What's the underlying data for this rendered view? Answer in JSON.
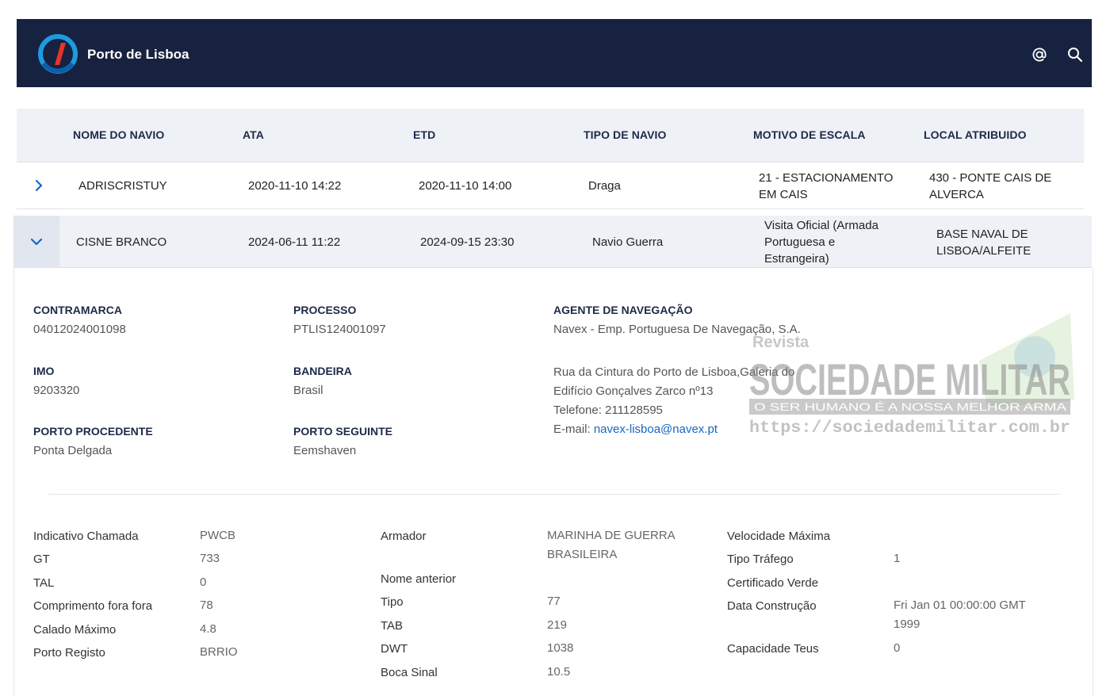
{
  "header": {
    "app_title": "Porto de Lisboa",
    "icons": [
      "at-icon",
      "search-icon"
    ]
  },
  "table": {
    "columns": [
      "NOME DO NAVIO",
      "ATA",
      "ETD",
      "TIPO DE NAVIO",
      "MOTIVO DE ESCALA",
      "LOCAL ATRIBUIDO"
    ],
    "rows": [
      {
        "name": "ADRISCRISTUY",
        "ata": "2020-11-10 14:22",
        "etd": "2020-11-10 14:00",
        "tipo": "Draga",
        "motivo": [
          "21 - ESTACIONAMENTO",
          "EM CAIS"
        ],
        "local": [
          "430 - PONTE CAIS DE",
          "ALVERCA"
        ],
        "expanded": false
      },
      {
        "name": "CISNE BRANCO",
        "ata": "2024-06-11 11:22",
        "etd": "2024-09-15 23:30",
        "tipo": "Navio Guerra",
        "motivo": [
          "Visita Oficial (Armada",
          "Portuguesa e",
          "Estrangeira)"
        ],
        "local": [
          "BASE NAVAL DE",
          "LISBOA/ALFEITE"
        ],
        "expanded": true
      }
    ]
  },
  "detail": {
    "contramarca": {
      "label": "CONTRAMARCA",
      "value": "04012024001098"
    },
    "processo": {
      "label": "PROCESSO",
      "value": "PTLIS124001097"
    },
    "agente": {
      "label": "AGENTE DE NAVEGAÇÃO",
      "name": "Navex - Emp. Portuguesa De Navegação, S.A.",
      "addr1": "Rua da Cintura do Porto de Lisboa,Galeria do",
      "addr2": "Edifício Gonçalves Zarco nº13",
      "phone": "Telefone: 211128595",
      "email_label": "E-mail: ",
      "email": "navex-lisboa@navex.pt"
    },
    "imo": {
      "label": "IMO",
      "value": "9203320"
    },
    "bandeira": {
      "label": "BANDEIRA",
      "value": "Brasil"
    },
    "porto_procedente": {
      "label": "PORTO PROCEDENTE",
      "value": "Ponta Delgada"
    },
    "porto_seguinte": {
      "label": "PORTO SEGUINTE",
      "value": "Eemshaven"
    },
    "specs_col1": [
      {
        "k": "Indicativo Chamada",
        "v": "PWCB"
      },
      {
        "k": "GT",
        "v": "733"
      },
      {
        "k": "TAL",
        "v": "0"
      },
      {
        "k": "Comprimento fora fora",
        "v": "78"
      },
      {
        "k": "Calado Máximo",
        "v": "4.8"
      },
      {
        "k": "Porto Registo",
        "v": "BRRIO"
      }
    ],
    "specs_col2": [
      {
        "k": "Armador",
        "v": "MARINHA DE GUERRA",
        "v2": "BRASILEIRA"
      },
      {
        "k": "Nome anterior",
        "v": ""
      },
      {
        "k": "Tipo",
        "v": "77"
      },
      {
        "k": "TAB",
        "v": "219"
      },
      {
        "k": "DWT",
        "v": "1038"
      },
      {
        "k": "Boca Sinal",
        "v": "10.5"
      }
    ],
    "specs_col3": [
      {
        "k": "Velocidade Máxima",
        "v": ""
      },
      {
        "k": "Tipo Tráfego",
        "v": "1"
      },
      {
        "k": "Certificado Verde",
        "v": ""
      },
      {
        "k": "Data Construção",
        "v": "Fri Jan 01 00:00:00 GMT",
        "v2": "1999"
      },
      {
        "k": "Capacidade Teus",
        "v": "0"
      }
    ]
  },
  "watermark": {
    "line1": "Revista",
    "line2": "SOCIEDADE MILITAR",
    "line3": "O SER HUMANO É A NOSSA MELHOR ARMA",
    "line4": "https://sociedademilitar.com.br"
  },
  "colors": {
    "header_bg": "#16223f",
    "accent": "#1766c2",
    "table_head_bg": "#eef1f5"
  }
}
